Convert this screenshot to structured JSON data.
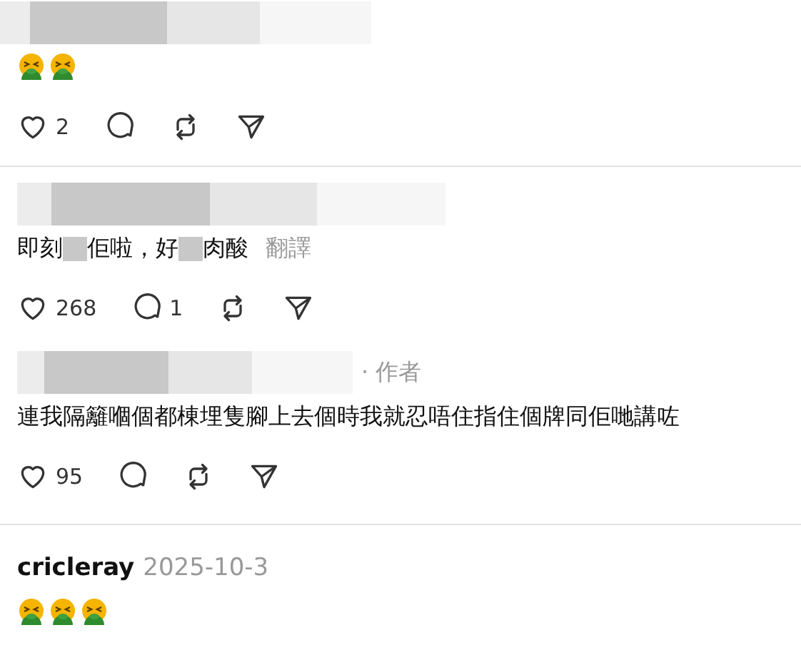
{
  "posts": [
    {
      "author": {
        "kind": "blurred"
      },
      "body": {
        "kind": "emojis",
        "emojis": [
          {
            "kind": "vomit"
          },
          {
            "kind": "vomit"
          }
        ]
      },
      "actions": {
        "likes": "2"
      }
    },
    {
      "author": {
        "kind": "blurred"
      },
      "body": {
        "kind": "text",
        "segments": [
          {
            "kind": "text",
            "text": "即刻"
          },
          {
            "kind": "redacted"
          },
          {
            "kind": "text",
            "text": "佢啦，好"
          },
          {
            "kind": "redacted"
          },
          {
            "kind": "text",
            "text": "肉酸"
          }
        ],
        "translate": "翻譯"
      },
      "actions": {
        "likes": "268",
        "replies": "1"
      }
    },
    {
      "author": {
        "kind": "blurred",
        "badge": "· 作者"
      },
      "body": {
        "kind": "text",
        "segments": [
          {
            "kind": "text",
            "text": "連我隔籬嗰個都棟埋隻腳上去個時我就忍唔住指住個牌同佢哋講咗"
          }
        ]
      },
      "actions": {
        "likes": "95"
      }
    },
    {
      "author": {
        "kind": "plain",
        "name": "cricleray",
        "date": "2025-10-3"
      },
      "body": {
        "kind": "emojis",
        "emojis": [
          {
            "kind": "vomit"
          },
          {
            "kind": "vomit"
          },
          {
            "kind": "vomit"
          }
        ]
      }
    }
  ]
}
